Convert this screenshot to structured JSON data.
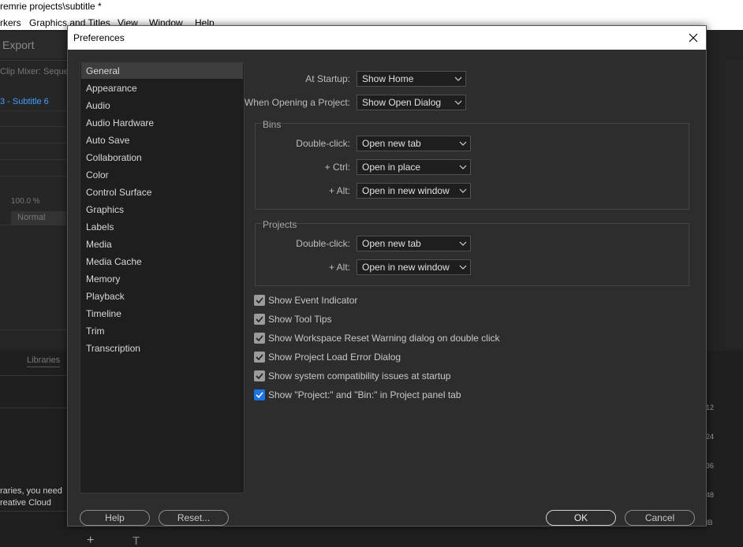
{
  "app": {
    "title": "remrie projects\\subtitle *",
    "menu": [
      "rkers",
      "Graphics and Titles",
      "View",
      "Window",
      "Help"
    ],
    "export_label": "Export",
    "clip_mixer": "Clip Mixer: Seque",
    "subtitle_tab": "3 - Subtitle 6",
    "opacity": "100.0 %",
    "blend_mode": "Normal",
    "libraries_tab": "Libraries",
    "libraries_msg_line1": "raries, you need",
    "libraries_msg_line2": "reative Cloud",
    "timeline_ticks": [
      "12",
      "24",
      "36",
      "48",
      "IB"
    ]
  },
  "dialog": {
    "title": "Preferences",
    "categories": [
      "General",
      "Appearance",
      "Audio",
      "Audio Hardware",
      "Auto Save",
      "Collaboration",
      "Color",
      "Control Surface",
      "Graphics",
      "Labels",
      "Media",
      "Media Cache",
      "Memory",
      "Playback",
      "Timeline",
      "Trim",
      "Transcription"
    ],
    "selected_category": "General",
    "at_startup": {
      "label": "At Startup:",
      "value": "Show Home"
    },
    "when_opening": {
      "label": "When Opening a Project:",
      "value": "Show Open Dialog"
    },
    "bins": {
      "title": "Bins",
      "double_click": {
        "label": "Double-click:",
        "value": "Open new tab"
      },
      "ctrl": {
        "label": "+ Ctrl:",
        "value": "Open in place"
      },
      "alt": {
        "label": "+ Alt:",
        "value": "Open in new window"
      }
    },
    "projects": {
      "title": "Projects",
      "double_click": {
        "label": "Double-click:",
        "value": "Open new tab"
      },
      "alt": {
        "label": "+ Alt:",
        "value": "Open in new window"
      }
    },
    "checkboxes": [
      {
        "label": "Show Event Indicator",
        "checked": true,
        "accent": false
      },
      {
        "label": "Show Tool Tips",
        "checked": true,
        "accent": false
      },
      {
        "label": "Show Workspace Reset Warning dialog on double click",
        "checked": true,
        "accent": false
      },
      {
        "label": "Show Project Load Error Dialog",
        "checked": true,
        "accent": false
      },
      {
        "label": "Show system compatibility issues at startup",
        "checked": true,
        "accent": false
      },
      {
        "label": "Show \"Project:\" and \"Bin:\" in Project panel tab",
        "checked": true,
        "accent": true
      }
    ],
    "buttons": {
      "help": "Help",
      "reset": "Reset...",
      "ok": "OK",
      "cancel": "Cancel"
    }
  },
  "colors": {
    "accent": "#1a73e8",
    "dialog_bg": "#2d2d2d",
    "list_bg": "#1e1e1e",
    "selected_bg": "#3e3e3e",
    "link_blue": "#3f9fff"
  }
}
